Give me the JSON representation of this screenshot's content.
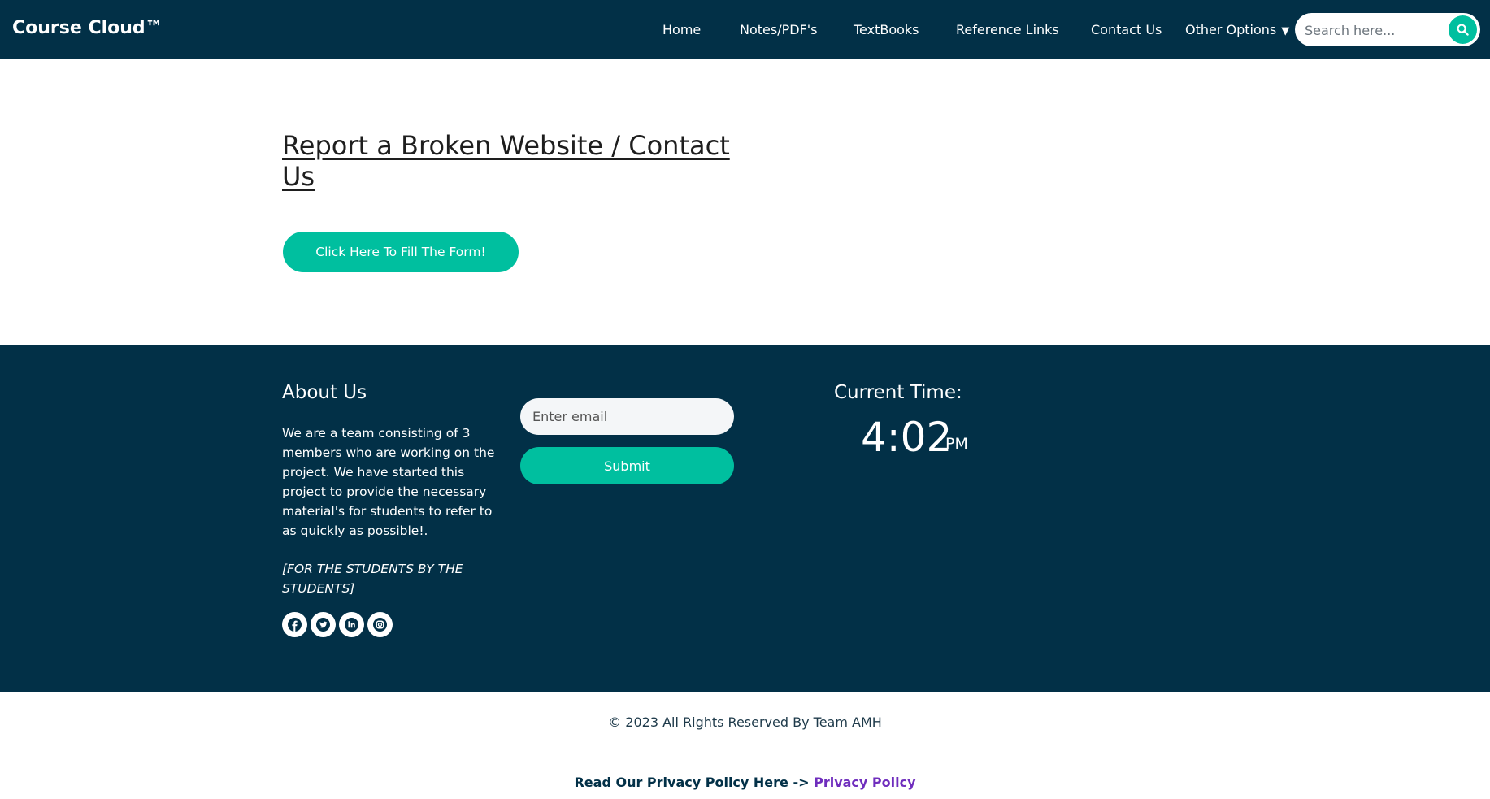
{
  "navbar": {
    "brand": "Course Cloud™",
    "links": {
      "home": "Home",
      "notes": "Notes/PDF's",
      "textbooks": "TextBooks",
      "reference": "Reference Links",
      "contact": "Contact Us",
      "other": "Other Options"
    },
    "other_caret": "▼",
    "search": {
      "placeholder": "Search here...",
      "value": ""
    }
  },
  "main": {
    "heading": "Report a Broken Website / Contact Us",
    "form_button": "Click Here To Fill The Form!"
  },
  "footer": {
    "about_title": "About Us",
    "about_text": "We are a team consisting of 3 members who are working on the project. We have started this project to provide the necessary material's for students to refer to as quickly as possible!.",
    "motto": "[FOR THE STUDENTS BY THE STUDENTS]",
    "socials": [
      "facebook-icon",
      "twitter-icon",
      "linkedin-icon",
      "instagram-icon"
    ],
    "email_placeholder": "Enter email",
    "submit_label": "Submit",
    "time_title": "Current Time:",
    "time_value": "4:02",
    "time_ampm": "PM"
  },
  "bottom": {
    "copyright": "© 2023 All Rights Reserved By Team AMH",
    "privacy_prefix": "Read Our Privacy Policy Here -> ",
    "privacy_link": "Privacy Policy"
  },
  "colors": {
    "navy": "#023047",
    "accent": "#00bf9f",
    "link": "#6f2dbd"
  }
}
